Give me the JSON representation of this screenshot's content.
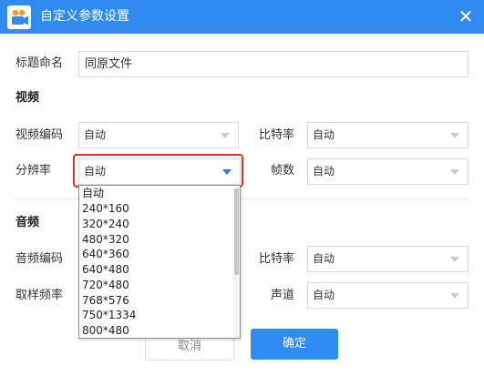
{
  "window": {
    "title": "自定义参数设置",
    "close_glyph": "✕",
    "accent": "#2f8bf0"
  },
  "title_field": {
    "label": "标题命名",
    "value": "同原文件"
  },
  "video": {
    "heading": "视频",
    "codec": {
      "label": "视频编码",
      "value": "自动"
    },
    "bitrate": {
      "label": "比特率",
      "value": "自动"
    },
    "resolution": {
      "label": "分辨率",
      "value": "自动"
    },
    "framerate": {
      "label": "帧数",
      "value": "自动"
    }
  },
  "audio": {
    "heading": "音频",
    "codec": {
      "label": "音频编码"
    },
    "bitrate": {
      "label": "比特率",
      "value": "自动"
    },
    "samplerate": {
      "label": "取样频率"
    },
    "channel": {
      "label": "声道",
      "value": "自动"
    }
  },
  "resolution_dropdown": {
    "options": [
      "自动",
      "240*160",
      "320*240",
      "480*320",
      "640*360",
      "640*480",
      "720*480",
      "768*576",
      "750*1334",
      "800*480"
    ]
  },
  "buttons": {
    "cancel": "取消",
    "ok": "确定"
  },
  "icons": {
    "app": "video-camera-icon",
    "close": "close-icon",
    "dropdown": "chevron-down-icon"
  }
}
